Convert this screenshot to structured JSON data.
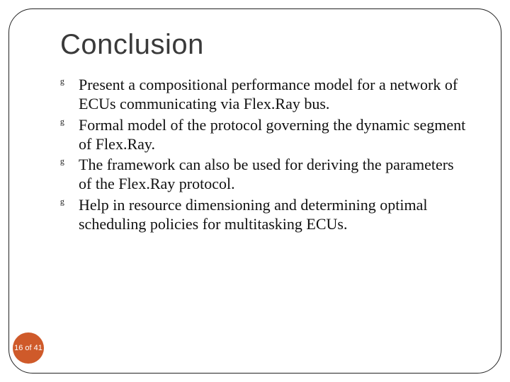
{
  "slide": {
    "title": "Conclusion",
    "bullets": [
      "Present a compositional performance model for a network of ECUs communicating via Flex.Ray bus.",
      "Formal model of the protocol governing the dynamic segment of Flex.Ray.",
      "The framework can also be used for deriving the parameters of the Flex.Ray protocol.",
      "Help in resource dimensioning and determining optimal scheduling policies for multitasking ECUs."
    ],
    "page_label": "16 of 41"
  }
}
